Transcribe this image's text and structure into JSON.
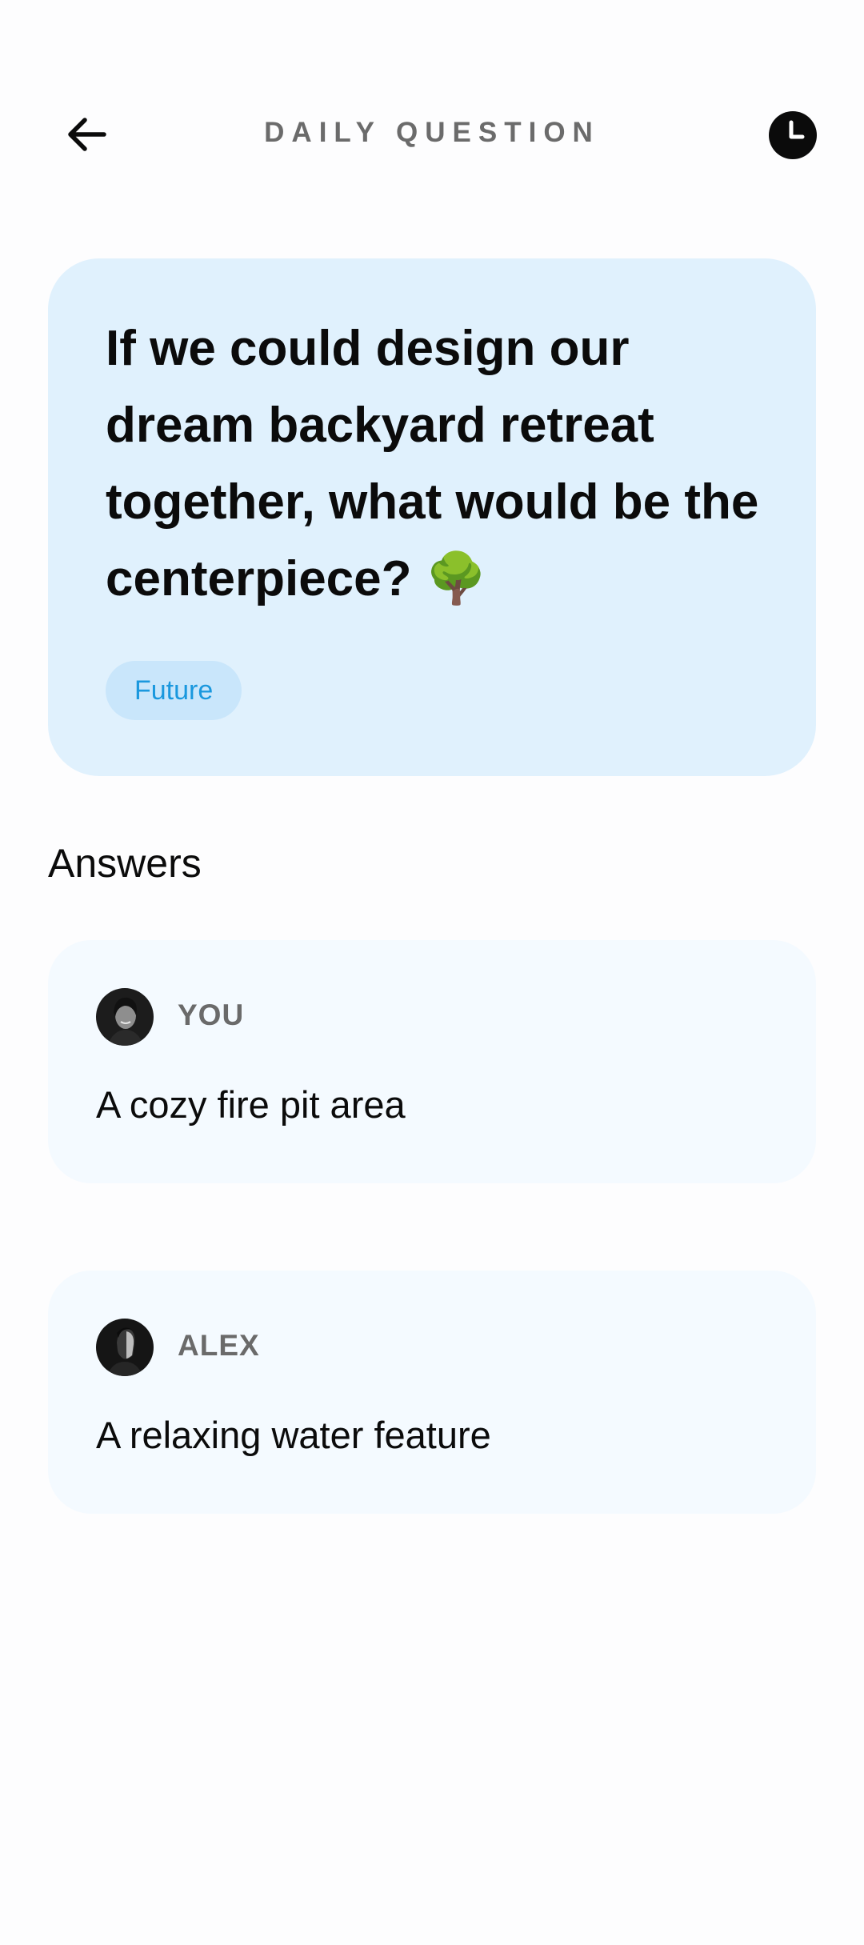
{
  "header": {
    "title": "DAILY QUESTION",
    "back_icon": "arrow-left-icon",
    "history_icon": "clock-icon"
  },
  "question": {
    "text": "If we could design our dream backyard retreat together, what would be the centerpiece? 🌳",
    "tag": "Future",
    "card_color": "#e0f1fd",
    "tag_color": "#1a98de"
  },
  "answers": {
    "heading": "Answers",
    "items": [
      {
        "name": "YOU",
        "text": "A cozy fire pit area"
      },
      {
        "name": "ALEX",
        "text": "A relaxing water feature"
      }
    ]
  }
}
